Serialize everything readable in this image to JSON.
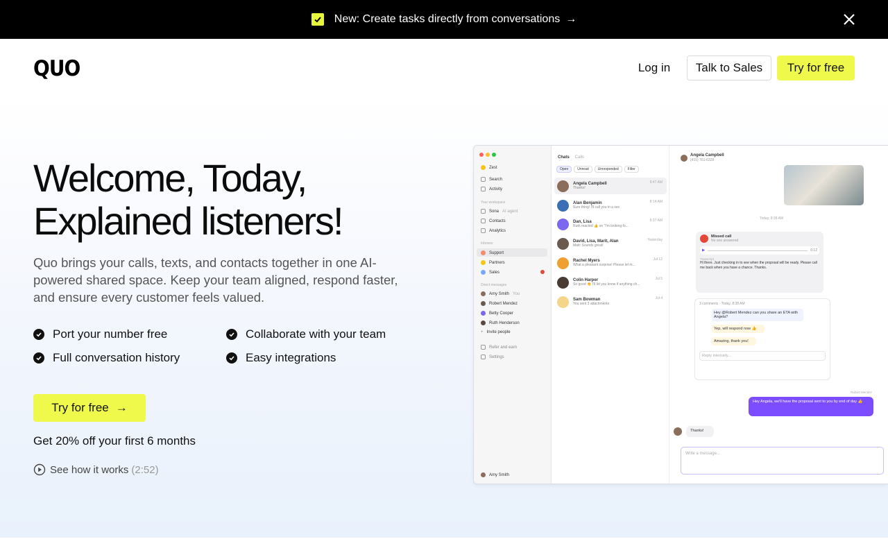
{
  "announcement": {
    "text": "New: Create tasks directly from conversations",
    "arrow": "→"
  },
  "header": {
    "logo": "QUO",
    "login": "Log in",
    "talk_to_sales": "Talk to Sales",
    "try_free": "Try for free"
  },
  "hero": {
    "headline_line1": "Welcome, Today,",
    "headline_line2": "Explained listeners!",
    "subtext": "Quo brings your calls, texts, and contacts together in one AI-powered shared space. Keep your team aligned, respond faster, and ensure every customer feels valued.",
    "features": [
      "Port your number free",
      "Collaborate with your team",
      "Full conversation history",
      "Easy integrations"
    ],
    "cta": "Try for free",
    "cta_arrow": "→",
    "offer": "Get 20% off your first 6 months",
    "how_label": "See how it works",
    "how_duration": "(2:52)"
  },
  "mock": {
    "workspace": "Zest",
    "sidebar": {
      "search": "Search",
      "activity": "Activity",
      "workspace_head": "Your workspace",
      "sona": "Sona",
      "sona_tag": "AI agent",
      "contacts": "Contacts",
      "analytics": "Analytics",
      "inboxes_head": "Inboxes",
      "support": "Support",
      "partners": "Partners",
      "sales": "Sales",
      "dm_head": "Direct messages",
      "dm1": "Amy Smith",
      "dm1_tag": "You",
      "dm2": "Robert Mendez",
      "dm3": "Betty Cooper",
      "dm4": "Ruth Henderson",
      "invite": "Invite people",
      "refer": "Refer and earn",
      "settings": "Settings",
      "user": "Amy Smith"
    },
    "list": {
      "tab_chats": "Chats",
      "tab_calls": "Calls",
      "filters": [
        "Open",
        "Unread",
        "Unresponded",
        "Filter"
      ],
      "items": [
        {
          "name": "Angela Campbell",
          "sub": "Thanks!",
          "time": "9:47 AM"
        },
        {
          "name": "Alan Benjamin",
          "sub": "Sure thing! I'll call you in a sec",
          "time": "8:14 AM"
        },
        {
          "name": "Dan, Lisa",
          "sub": "Ruth reacted 👍 on \"I'm looking fo...",
          "time": "6:37 AM"
        },
        {
          "name": "David, Lisa, Marit, Alan",
          "sub": "Matt: Sounds great!",
          "time": "Yesterday"
        },
        {
          "name": "Rachel Myers",
          "sub": "What a pleasant surprise! Please let m...",
          "time": "Jul 12"
        },
        {
          "name": "Colin Harper",
          "sub": "So good 👏 I'll let you know if anything ch...",
          "time": "Jul 5"
        },
        {
          "name": "Sam Bowman",
          "sub": "You sent 3 attachments",
          "time": "Jul 4"
        }
      ]
    },
    "chat": {
      "contact": "Angela Campbell",
      "phone": "(415) 761-6328",
      "date": "Today, 8:38 AM",
      "missed_call": "Missed call",
      "missed_sub": "No one answered",
      "audio_time": "0:12",
      "transcript_label": "Transcript",
      "transcript": "Hi there. Just checking in to see when the proposal will be ready. Please call me back when you have a chance. Thanks.",
      "thread_meta": "3 comments · Today, 8:38 AM",
      "c1": "Hey @Robert Mendez can you share an ETA with Angela?",
      "c2": "Yep, will respond now 👍",
      "c3": "Amazing, thank you!",
      "reply_placeholder": "Reply internally...",
      "sender": "Robert Mendez",
      "outgoing": "Hey Angela, we'll have the proposal sent to you by end of day 👍",
      "incoming": "Thanks!",
      "composer_placeholder": "Write a message..."
    }
  },
  "colors": {
    "accent": "#eef94b",
    "announce_bg": "#000000",
    "purple": "#7c4dff"
  }
}
